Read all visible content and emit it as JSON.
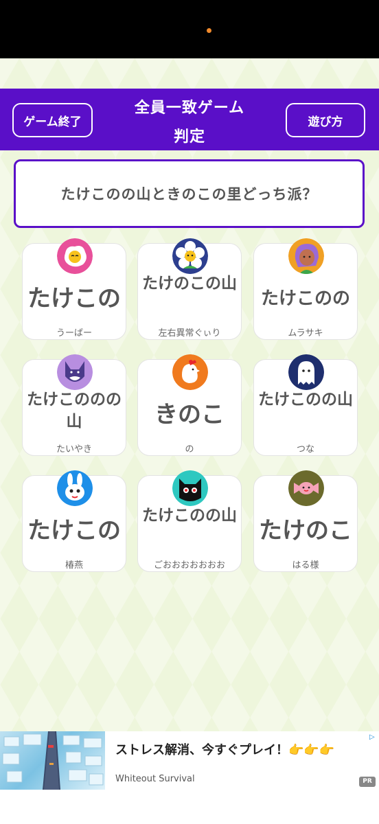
{
  "header": {
    "title_line1": "全員一致ゲーム",
    "title_line2": "判定",
    "end_button": "ゲーム終了",
    "howto_button": "遊び方"
  },
  "question": "たけこのの山ときのこの里どっち派？",
  "answers": [
    {
      "answer": "たけこの",
      "player": "うーばー",
      "icon": "egg-icon"
    },
    {
      "answer": "たけのこの山",
      "player": "左右異常ぐぃり",
      "icon": "flower-icon"
    },
    {
      "answer": "たけこのの",
      "player": "ムラサキ",
      "icon": "girl-icon"
    },
    {
      "answer": "たけこののの山",
      "player": "たいやき",
      "icon": "wolf-icon"
    },
    {
      "answer": "きのこ",
      "player": "の",
      "icon": "chicken-icon"
    },
    {
      "answer": "たけこのの山",
      "player": "つな",
      "icon": "ghost-icon"
    },
    {
      "answer": "たけこの",
      "player": "椿燕",
      "icon": "rabbit-icon"
    },
    {
      "answer": "たけこのの山",
      "player": "ごおおおおおおお",
      "icon": "cat-icon"
    },
    {
      "answer": "たけのこ",
      "player": "はる様",
      "icon": "candy-icon"
    }
  ],
  "ad": {
    "headline": "ストレス解消、今すぐプレイ！👉👉👉",
    "advertiser": "Whiteout Survival",
    "badge": "PR"
  },
  "colors": {
    "brand_purple": "#5a0fc8",
    "background": "#eef6dc"
  }
}
